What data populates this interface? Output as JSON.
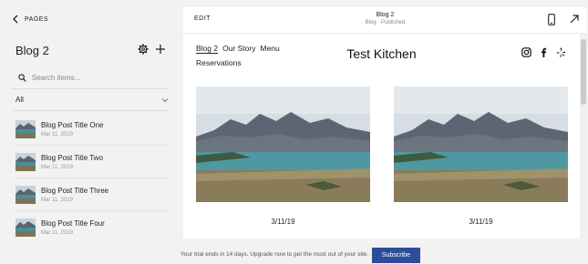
{
  "sidebar": {
    "back_label": "PAGES",
    "page_title": "Blog 2",
    "search_placeholder": "Search items...",
    "filter_value": "All",
    "posts": [
      {
        "title": "Blog Post Title One",
        "date": "Mar 11, 2019"
      },
      {
        "title": "Blog Post Title Two",
        "date": "Mar 11, 2019"
      },
      {
        "title": "Blog Post Title Three",
        "date": "Mar 11, 2019"
      },
      {
        "title": "Blog Post Title Four",
        "date": "Mar 11, 2019"
      }
    ]
  },
  "preview": {
    "edit_label": "EDIT",
    "page_name": "Blog 2",
    "page_status": "Blog · Published",
    "site": {
      "nav": [
        "Blog 2",
        "Our Story",
        "Menu",
        "Reservations"
      ],
      "title": "Test Kitchen",
      "social_icons": [
        "instagram-icon",
        "facebook-icon",
        "yelp-icon"
      ],
      "cards": [
        {
          "date": "3/11/19"
        },
        {
          "date": "3/11/19"
        }
      ]
    }
  },
  "banner": {
    "text": "Your trial ends in 14 days. Upgrade now to get the most out of your site.",
    "button_label": "Subscribe"
  },
  "colors": {
    "accent": "#2b4e9c",
    "background": "#f2f2f2"
  }
}
